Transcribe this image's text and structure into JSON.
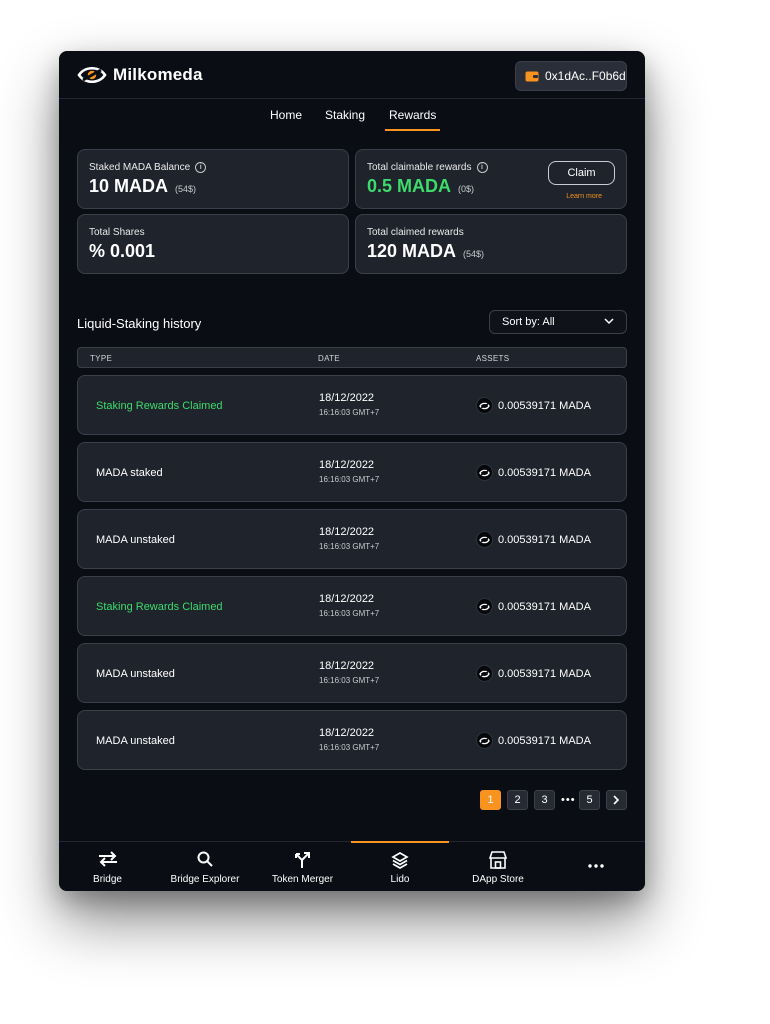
{
  "app": {
    "name": "Milkomeda"
  },
  "wallet": {
    "address": "0x1dAc..F0b6d"
  },
  "nav": {
    "tabs": [
      "Home",
      "Staking",
      "Rewards"
    ],
    "active": "Rewards"
  },
  "summary": {
    "staked_balance": {
      "label": "Staked MADA Balance",
      "value": "10 MADA",
      "fiat": "(54$)"
    },
    "claimable": {
      "label": "Total claimable rewards",
      "value": "0.5 MADA",
      "fiat": "(0$)",
      "button": "Claim",
      "learn_more": "Learn more"
    },
    "total_shares": {
      "label": "Total Shares",
      "value": "% 0.001"
    },
    "total_claimed": {
      "label": "Total claimed rewards",
      "value": "120 MADA",
      "fiat": "(54$)"
    }
  },
  "history": {
    "title": "Liquid-Staking history",
    "sort_label": "Sort by: All",
    "columns": [
      "TYPE",
      "DATE",
      "ASSETS"
    ],
    "rows": [
      {
        "type": "Staking Rewards Claimed",
        "date": "18/12/2022",
        "time": "16:16:03 GMT+7",
        "asset": "0.00539171 MADA",
        "claimed": true
      },
      {
        "type": "MADA staked",
        "date": "18/12/2022",
        "time": "16:16:03 GMT+7",
        "asset": "0.00539171 MADA",
        "claimed": false
      },
      {
        "type": "MADA unstaked",
        "date": "18/12/2022",
        "time": "16:16:03 GMT+7",
        "asset": "0.00539171 MADA",
        "claimed": false
      },
      {
        "type": "Staking Rewards Claimed",
        "date": "18/12/2022",
        "time": "16:16:03 GMT+7",
        "asset": "0.00539171 MADA",
        "claimed": true
      },
      {
        "type": "MADA unstaked",
        "date": "18/12/2022",
        "time": "16:16:03 GMT+7",
        "asset": "0.00539171 MADA",
        "claimed": false
      },
      {
        "type": "MADA unstaked",
        "date": "18/12/2022",
        "time": "16:16:03 GMT+7",
        "asset": "0.00539171 MADA",
        "claimed": false
      }
    ]
  },
  "pagination": {
    "pages": [
      "1",
      "2",
      "3",
      "5"
    ],
    "ellipsis": "•••",
    "current": "1",
    "next_icon": "chevron-right-icon"
  },
  "bottom_nav": {
    "items": [
      {
        "label": "Bridge",
        "icon": "bridge-arrows-icon"
      },
      {
        "label": "Bridge Explorer",
        "icon": "search-icon"
      },
      {
        "label": "Token Merger",
        "icon": "merge-icon"
      },
      {
        "label": "Lido",
        "icon": "layers-icon"
      },
      {
        "label": "DApp Store",
        "icon": "store-icon"
      },
      {
        "label": "",
        "icon": "more-icon"
      }
    ],
    "active": "Lido"
  },
  "colors": {
    "accent": "#f7931e",
    "positive": "#3ddb6c",
    "background": "#0a0d13",
    "card": "#1f232b"
  }
}
